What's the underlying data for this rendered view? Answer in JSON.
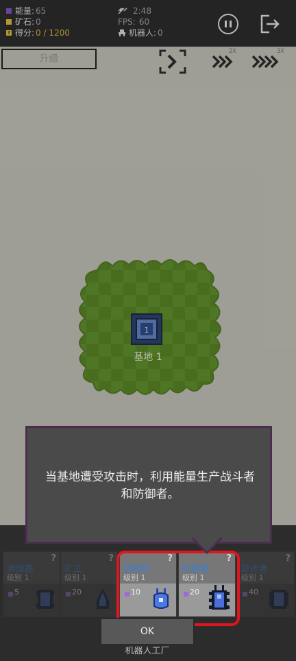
{
  "hud": {
    "energy_label": "能量:",
    "energy_value": "65",
    "ore_label": "矿石:",
    "ore_value": "0",
    "score_label": "得分:",
    "score_value": "0 / 1200",
    "time_value": "2:48",
    "fps_label": "FPS:",
    "fps_value": "60",
    "robots_label": "机器人:",
    "robots_value": "0",
    "score_icon_glyph": "?"
  },
  "toolbar": {
    "upgrade_label": "升级",
    "speed_2x_label": "2X",
    "speed_3x_label": "3X"
  },
  "base": {
    "label": "基地 1",
    "core_label": "1"
  },
  "tooltip": {
    "text": "当基地遭受攻击时，利用能量生产战斗者和防御者。"
  },
  "units": [
    {
      "name": "清除器",
      "level": "级别 1",
      "cost": "5",
      "icon": "sweeper-robot-icon"
    },
    {
      "name": "矿工",
      "level": "级别 1",
      "cost": "20",
      "icon": "miner-robot-icon"
    },
    {
      "name": "侦察兵",
      "level": "级别 1",
      "cost": "10",
      "icon": "scout-robot-icon"
    },
    {
      "name": "防御者",
      "level": "级别 1",
      "cost": "20",
      "icon": "defender-robot-icon"
    },
    {
      "name": "建造者",
      "level": "级别 1",
      "cost": "40",
      "icon": "builder-robot-icon"
    }
  ],
  "help_glyph": "?",
  "dialog": {
    "ok_label": "OK",
    "under_label": "机器人工厂"
  },
  "colors": {
    "accent_purple": "#7b4fb8",
    "ore_gold": "#d4b23a",
    "unit_name_blue": "#3c7ed6",
    "highlight_red": "#e0161e",
    "base_green": "#5f8a2c"
  }
}
